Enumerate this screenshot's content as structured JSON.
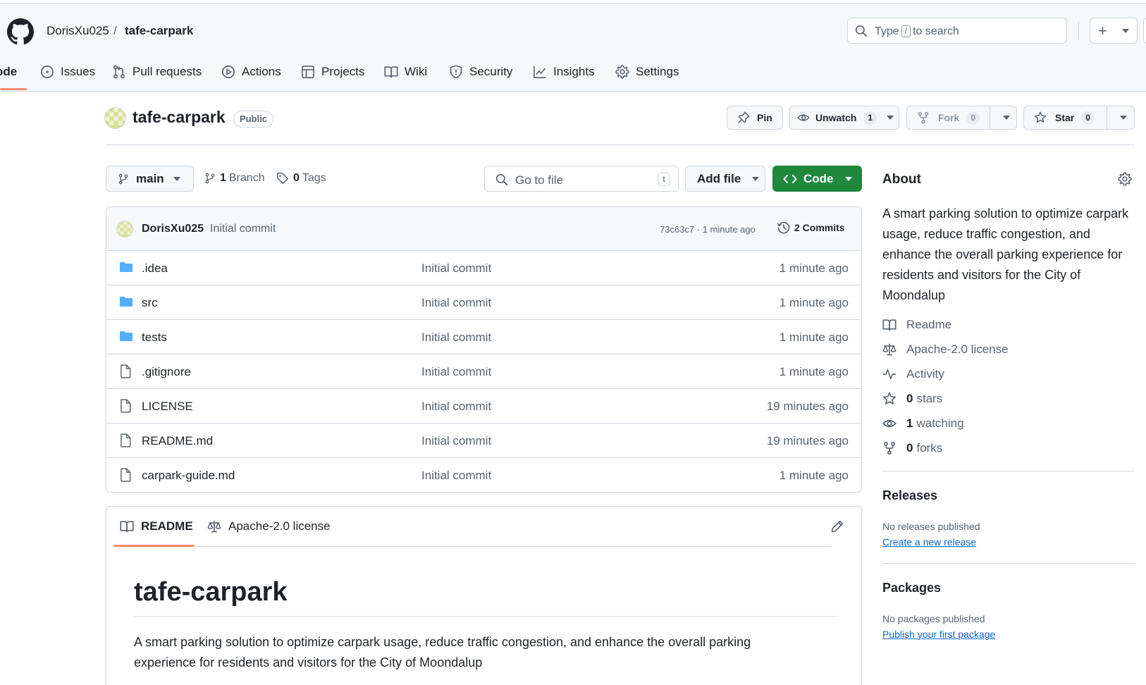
{
  "header": {
    "owner": "DorisXu025",
    "separator": "/",
    "repo": "tafe-carpark",
    "search": {
      "prefix": "Type",
      "key": "/",
      "suffix": "to search"
    },
    "plus_symbol": "+"
  },
  "nav": {
    "tabs": [
      {
        "label": "ode",
        "icon": "code-icon",
        "active": true
      },
      {
        "label": "Issues",
        "icon": "issue-icon"
      },
      {
        "label": "Pull requests",
        "icon": "pull-request-icon"
      },
      {
        "label": "Actions",
        "icon": "play-icon"
      },
      {
        "label": "Projects",
        "icon": "table-icon"
      },
      {
        "label": "Wiki",
        "icon": "book-icon"
      },
      {
        "label": "Security",
        "icon": "shield-icon"
      },
      {
        "label": "Insights",
        "icon": "graph-icon"
      },
      {
        "label": "Settings",
        "icon": "gear-icon"
      }
    ]
  },
  "repo_head": {
    "name": "tafe-carpark",
    "visibility": "Public",
    "pin": "Pin",
    "unwatch": "Unwatch",
    "watch_count": "1",
    "fork": "Fork",
    "fork_count": "0",
    "star": "Star",
    "star_count": "0"
  },
  "toolbar": {
    "branch": "main",
    "branches_count": "1",
    "branches_label": "Branch",
    "tags_count": "0",
    "tags_label": "Tags",
    "goto_placeholder": "Go to file",
    "goto_key": "t",
    "add_file": "Add file",
    "code": "Code"
  },
  "latest_commit": {
    "author": "DorisXu025",
    "message": "Initial commit",
    "meta": "73c63c7 · 1 minute ago",
    "commits": "2 Commits"
  },
  "files": [
    {
      "name": ".idea",
      "type": "folder",
      "message": "Initial commit",
      "time": "1 minute ago"
    },
    {
      "name": "src",
      "type": "folder",
      "message": "Initial commit",
      "time": "1 minute ago"
    },
    {
      "name": "tests",
      "type": "folder",
      "message": "Initial commit",
      "time": "1 minute ago"
    },
    {
      "name": ".gitignore",
      "type": "file",
      "message": "Initial commit",
      "time": "1 minute ago"
    },
    {
      "name": "LICENSE",
      "type": "file",
      "message": "Initial commit",
      "time": "19 minutes ago"
    },
    {
      "name": "README.md",
      "type": "file",
      "message": "Initial commit",
      "time": "19 minutes ago"
    },
    {
      "name": "carpark-guide.md",
      "type": "file",
      "message": "Initial commit",
      "time": "1 minute ago"
    }
  ],
  "readme": {
    "tab_readme": "README",
    "tab_license": "Apache-2.0 license",
    "title": "tafe-carpark",
    "body": "A smart parking solution to optimize carpark usage, reduce traffic congestion, and enhance the overall parking experience for residents and visitors for the City of Moondalup"
  },
  "about": {
    "heading": "About",
    "description": "A smart parking solution to optimize carpark usage, reduce traffic congestion, and enhance the overall parking experience for residents and visitors for the City of Moondalup",
    "readme": "Readme",
    "license": "Apache-2.0 license",
    "activity": "Activity",
    "stars_count": "0",
    "stars_label": "stars",
    "watching_count": "1",
    "watching_label": "watching",
    "forks_count": "0",
    "forks_label": "forks"
  },
  "releases": {
    "heading": "Releases",
    "empty": "No releases published",
    "link": "Create a new release"
  },
  "packages": {
    "heading": "Packages",
    "empty": "No packages published",
    "link": "Publish your first package"
  },
  "colors": {
    "accent_underline": "#fd8c73",
    "code_button": "#1f883d",
    "link": "#0969da",
    "folder": "#54aeff"
  }
}
